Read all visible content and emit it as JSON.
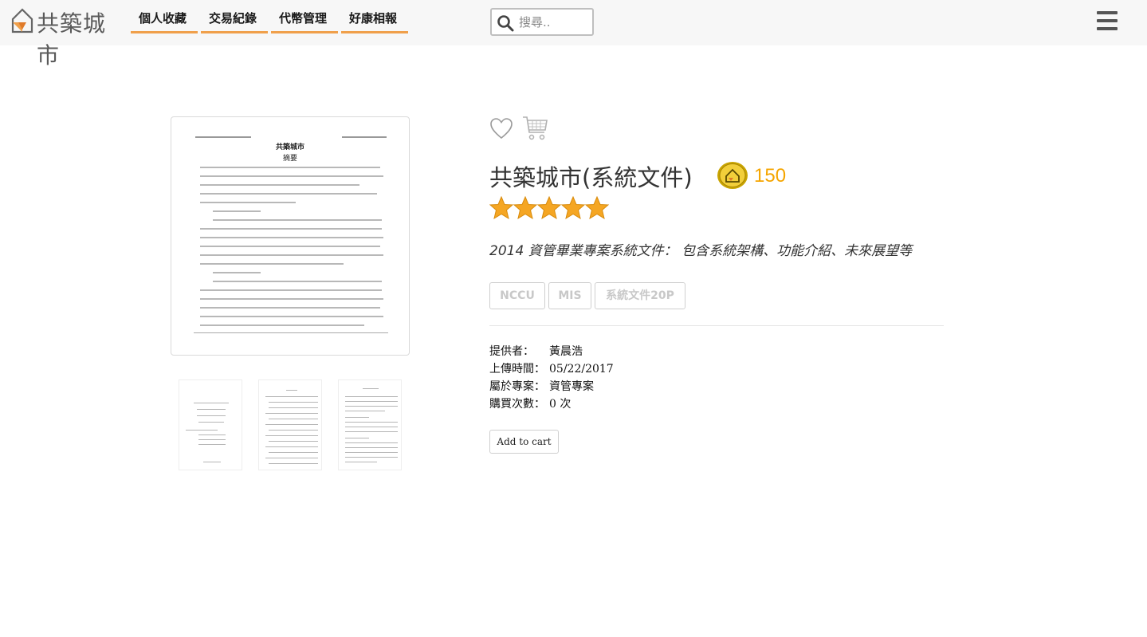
{
  "header": {
    "logo_text": "共築城市",
    "nav": [
      {
        "label": "個人收藏"
      },
      {
        "label": "交易紀錄"
      },
      {
        "label": "代幣管理"
      },
      {
        "label": "好康相報"
      }
    ],
    "search": {
      "placeholder": "搜尋..",
      "value": ""
    },
    "accent_color": "#f0a04b"
  },
  "preview": {
    "doc_title": "共築城市",
    "doc_subtitle": "摘要"
  },
  "product": {
    "title": "共築城市(系統文件)",
    "price": "150",
    "rating": 5,
    "rating_max": 5,
    "description": "2014 資管畢業專案系統文件： 包含系統架構、功能介紹、未來展望等",
    "tags": [
      "NCCU",
      "MIS",
      "系統文件20P"
    ],
    "info": [
      {
        "key": "提供者：",
        "value": "黃晨浩"
      },
      {
        "key": "上傳時間：",
        "value": "05/22/2017"
      },
      {
        "key": "屬於專案：",
        "value": "資管專案"
      },
      {
        "key": "購買次數：",
        "value": "0 次"
      }
    ],
    "add_to_cart_label": "Add to cart",
    "price_color": "#f5a500",
    "star_color": "#f5a623"
  }
}
